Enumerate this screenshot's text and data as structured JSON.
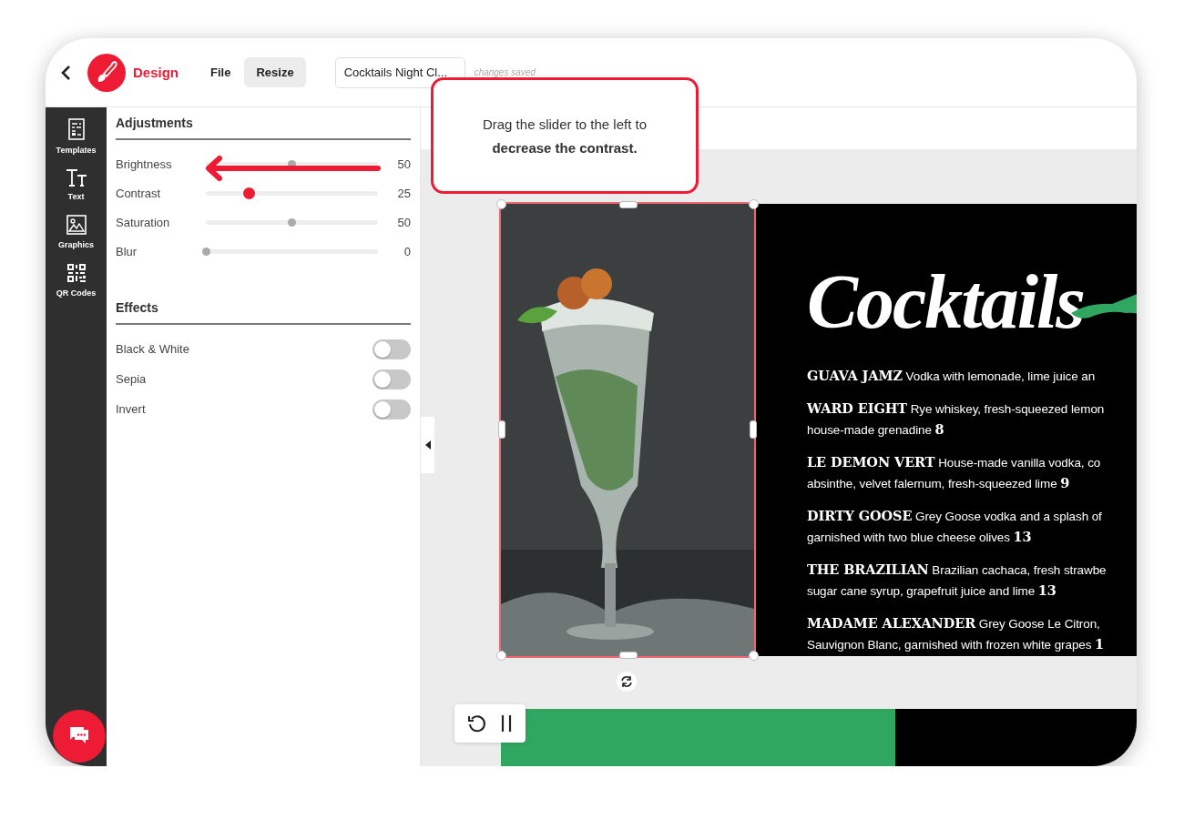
{
  "header": {
    "brand": "Design",
    "menu": [
      {
        "label": "File",
        "selected": false
      },
      {
        "label": "Resize",
        "selected": true
      }
    ],
    "document_title": "Cocktails Night Cl...",
    "save_status": "changes saved"
  },
  "rail": [
    {
      "kind": "templates",
      "label": "Templates"
    },
    {
      "kind": "text",
      "label": "Text"
    },
    {
      "kind": "graphics",
      "label": "Graphics"
    },
    {
      "kind": "qr",
      "label": "QR Codes"
    }
  ],
  "adjustments": {
    "title": "Adjustments",
    "sliders": [
      {
        "label": "Brightness",
        "level": 0.5,
        "value": "50",
        "active": false
      },
      {
        "label": "Contrast",
        "level": 0.25,
        "value": "25",
        "active": true
      },
      {
        "label": "Saturation",
        "level": 0.5,
        "value": "50",
        "active": false
      },
      {
        "label": "Blur",
        "level": 0,
        "value": "0",
        "active": false
      }
    ]
  },
  "effects": {
    "title": "Effects",
    "toggles": [
      {
        "label": "Black & White",
        "on": false
      },
      {
        "label": "Sepia",
        "on": false
      },
      {
        "label": "Invert",
        "on": false
      }
    ]
  },
  "tooltip": {
    "text": "Drag the slider to the left to **decrease the contrast.**"
  },
  "menu_card": {
    "photo": {
      "kind": "picture",
      "selected": true
    },
    "title": "Cocktails",
    "items": [
      {
        "lines": [
          "**GUAVA JAMZ** Vodka with lemonade, lime juice an"
        ]
      },
      {
        "lines": [
          "**WARD EIGHT** Rye whiskey, fresh-squeezed lemon",
          "house-made grenadine **8**"
        ]
      },
      {
        "lines": [
          "**LE DEMON VERT** House-made vanilla vodka, co",
          "absinthe, velvet falernum, fresh-squeezed lime **9**"
        ]
      },
      {
        "lines": [
          "**DIRTY GOOSE** Grey Goose vodka and a splash of",
          "garnished with two blue cheese olives **13**"
        ]
      },
      {
        "lines": [
          "**THE BRAZILIAN** Brazilian cachaca, fresh strawbe",
          "sugar cane syrup, grapefruit juice and lime **13**"
        ]
      },
      {
        "lines": [
          "**MADAME ALEXANDER** Grey Goose Le Citron,",
          "Sauvignon Blanc, garnished with frozen white grapes **1**"
        ]
      }
    ]
  }
}
